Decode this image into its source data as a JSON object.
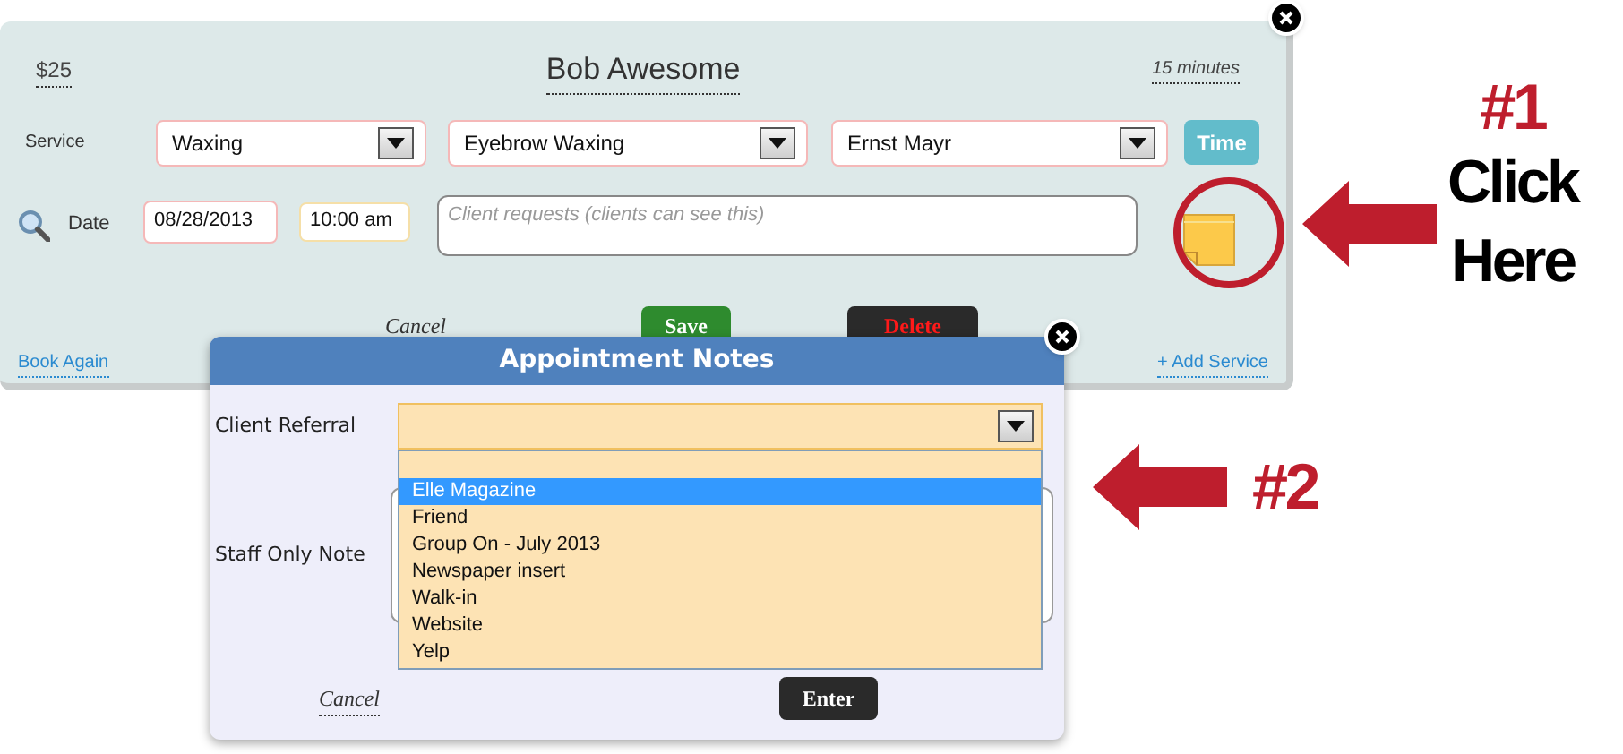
{
  "appointment": {
    "price": "$25",
    "client_name": "Bob Awesome",
    "duration": "15 minutes",
    "service_label": "Service",
    "service_selects": [
      {
        "value": "Waxing"
      },
      {
        "value": "Eyebrow Waxing"
      },
      {
        "value": "Ernst Mayr"
      }
    ],
    "time_button": "Time",
    "date_label": "Date",
    "date": "08/28/2013",
    "time": "10:00 am",
    "notes_placeholder": "Client requests (clients can see this)",
    "cancel": "Cancel",
    "save": "Save",
    "delete": "Delete",
    "book_again": "Book Again",
    "add_service": "+ Add Service"
  },
  "notes_dialog": {
    "title": "Appointment Notes",
    "referral_label": "Client Referral",
    "options": [
      {
        "label": "Elle Magazine",
        "selected": true
      },
      {
        "label": "Friend",
        "selected": false
      },
      {
        "label": "Group On - July 2013",
        "selected": false
      },
      {
        "label": "Newspaper insert",
        "selected": false
      },
      {
        "label": "Walk-in",
        "selected": false
      },
      {
        "label": "Website",
        "selected": false
      },
      {
        "label": "Yelp",
        "selected": false
      }
    ],
    "staff_note_label": "Staff Only Note",
    "cancel": "Cancel",
    "enter": "Enter"
  },
  "annotations": [
    {
      "number": "#1",
      "caption": [
        "Click",
        "Here"
      ]
    },
    {
      "number": "#2"
    }
  ]
}
